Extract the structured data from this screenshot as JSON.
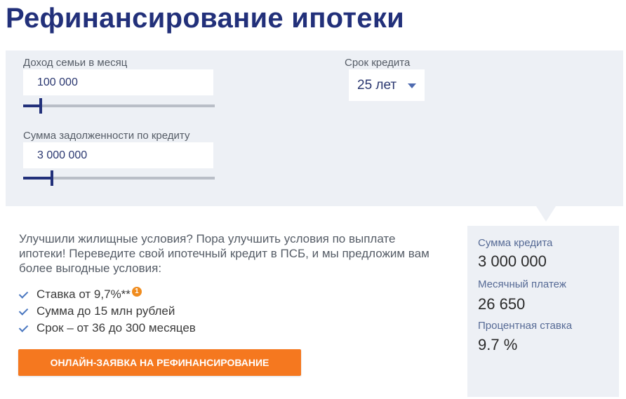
{
  "page": {
    "title": "Рефинансирование ипотеки"
  },
  "calculator": {
    "income": {
      "label": "Доход семьи в месяц",
      "value": "100 000",
      "slider_fraction": 0.09
    },
    "debt": {
      "label": "Сумма задолженности по кредиту",
      "value": "3 000 000",
      "slider_fraction": 0.15
    },
    "term": {
      "label": "Срок кредита",
      "selected": "25 лет"
    }
  },
  "promo": {
    "intro": "Улучшили жилищные условия? Пора улучшить условия по выплате ипотеки! Переведите свой ипотечный кредит в ПСБ, и мы предложим вам более выгодные условия:",
    "features": [
      {
        "text": "Ставка от 9,7%**",
        "badge": "1"
      },
      {
        "text": "Сумма до 15 млн рублей"
      },
      {
        "text": "Срок – от 36 до 300 месяцев"
      }
    ],
    "cta_label": "ОНЛАЙН-ЗАЯВКА НА РЕФИНАНСИРОВАНИЕ"
  },
  "result": {
    "loan_amount_label": "Сумма кредита",
    "loan_amount_value": "3 000 000",
    "monthly_payment_label": "Месячный платеж",
    "monthly_payment_value": "26 650",
    "rate_label": "Процентная ставка",
    "rate_value": "9.7 %"
  },
  "colors": {
    "brand_navy": "#22307a",
    "accent_orange": "#f5781f",
    "panel_bg": "#edf0f5"
  }
}
